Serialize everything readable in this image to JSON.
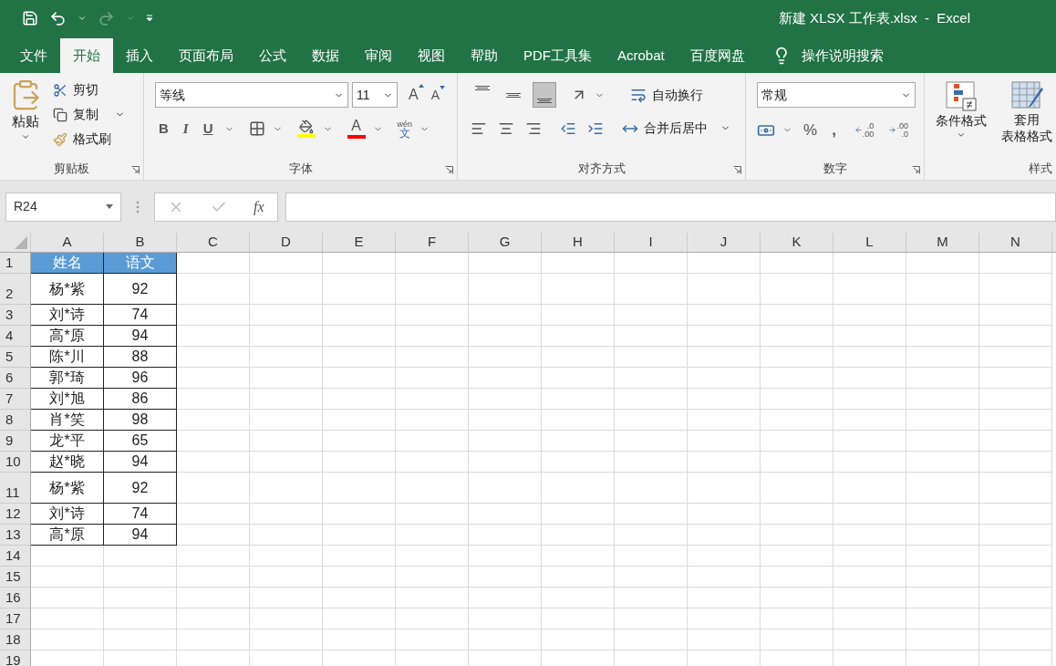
{
  "window": {
    "title": "新建 XLSX 工作表.xlsx  -  Excel"
  },
  "tabs": [
    {
      "label": "文件",
      "selected": false
    },
    {
      "label": "开始",
      "selected": true
    },
    {
      "label": "插入",
      "selected": false
    },
    {
      "label": "页面布局",
      "selected": false
    },
    {
      "label": "公式",
      "selected": false
    },
    {
      "label": "数据",
      "selected": false
    },
    {
      "label": "审阅",
      "selected": false
    },
    {
      "label": "视图",
      "selected": false
    },
    {
      "label": "帮助",
      "selected": false
    },
    {
      "label": "PDF工具集",
      "selected": false
    },
    {
      "label": "Acrobat",
      "selected": false
    },
    {
      "label": "百度网盘",
      "selected": false
    }
  ],
  "tell_me": "操作说明搜索",
  "ribbon": {
    "clipboard": {
      "label": "剪贴板",
      "paste": "粘贴",
      "cut": "剪切",
      "copy": "复制",
      "format_painter": "格式刷"
    },
    "font": {
      "label": "字体",
      "font_name": "等线",
      "font_size": "11",
      "grow": "A",
      "shrink": "A",
      "bold": "B",
      "italic": "I",
      "underline": "U",
      "font_color": "A",
      "phonetic_top": "wén",
      "phonetic_bottom": "文"
    },
    "alignment": {
      "label": "对齐方式",
      "vertical": [
        {
          "kind": "top",
          "selected": false
        },
        {
          "kind": "middle",
          "selected": false
        },
        {
          "kind": "bottom",
          "selected": true
        }
      ],
      "wrap": "自动换行",
      "merge": "合并后居中"
    },
    "number": {
      "label": "数字",
      "format": "常规",
      "percent": "%",
      "comma": ",",
      "increase_decimal": [
        ".0",
        ".00"
      ],
      "decrease_decimal": [
        ".00",
        ".0"
      ]
    },
    "styles": {
      "label": "样式",
      "conditional": "条件格式",
      "table_format": [
        "套用",
        "表格格式"
      ]
    }
  },
  "formula_bar": {
    "name_box": "R24",
    "fx": "fx"
  },
  "columns": [
    "A",
    "B",
    "C",
    "D",
    "E",
    "F",
    "G",
    "H",
    "I",
    "J",
    "K",
    "L",
    "M",
    "N"
  ],
  "rows": [
    {
      "number": "1",
      "tall": false,
      "header": true,
      "cells": [
        "姓名",
        "语文"
      ]
    },
    {
      "number": "2",
      "tall": true,
      "header": false,
      "cells": [
        "杨*紫",
        "92"
      ]
    },
    {
      "number": "3",
      "tall": false,
      "header": false,
      "cells": [
        "刘*诗",
        "74"
      ]
    },
    {
      "number": "4",
      "tall": false,
      "header": false,
      "cells": [
        "高*原",
        "94"
      ]
    },
    {
      "number": "5",
      "tall": false,
      "header": false,
      "cells": [
        "陈*川",
        "88"
      ]
    },
    {
      "number": "6",
      "tall": false,
      "header": false,
      "cells": [
        "郭*琦",
        "96"
      ]
    },
    {
      "number": "7",
      "tall": false,
      "header": false,
      "cells": [
        "刘*旭",
        "86"
      ]
    },
    {
      "number": "8",
      "tall": false,
      "header": false,
      "cells": [
        "肖*笑",
        "98"
      ]
    },
    {
      "number": "9",
      "tall": false,
      "header": false,
      "cells": [
        "龙*平",
        "65"
      ]
    },
    {
      "number": "10",
      "tall": false,
      "header": false,
      "cells": [
        "赵*晓",
        "94"
      ]
    },
    {
      "number": "11",
      "tall": true,
      "header": false,
      "cells": [
        "杨*紫",
        "92"
      ]
    },
    {
      "number": "12",
      "tall": false,
      "header": false,
      "cells": [
        "刘*诗",
        "74"
      ]
    },
    {
      "number": "13",
      "tall": false,
      "header": false,
      "cells": [
        "高*原",
        "94"
      ]
    },
    {
      "number": "14",
      "tall": false,
      "cells": []
    },
    {
      "number": "15",
      "tall": false,
      "cells": []
    },
    {
      "number": "16",
      "tall": false,
      "cells": []
    },
    {
      "number": "17",
      "tall": false,
      "cells": []
    },
    {
      "number": "18",
      "tall": false,
      "cells": []
    },
    {
      "number": "19",
      "tall": false,
      "cells": []
    }
  ]
}
